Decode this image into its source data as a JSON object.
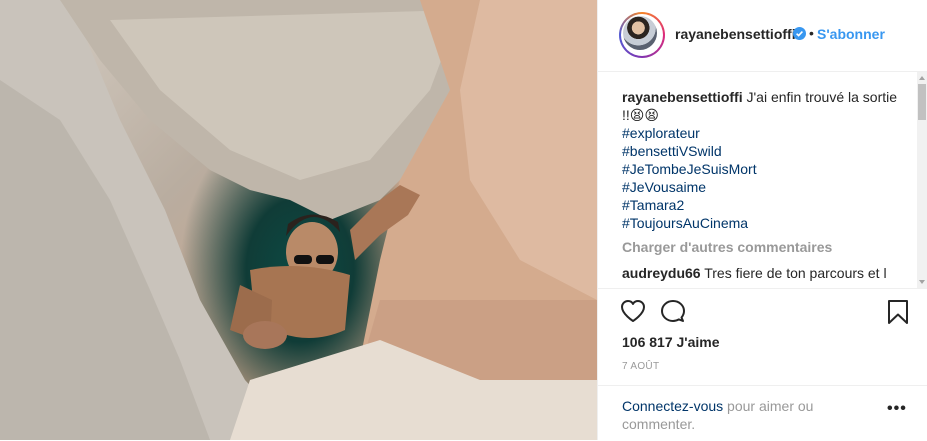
{
  "header": {
    "username": "rayanebensettioffi",
    "separator": "•",
    "follow_label": "S'abonner"
  },
  "caption": {
    "username": "rayanebensettioffi",
    "text": "J'ai enfin trouvé la sortie !!😫😫",
    "hashtags": [
      "#explorateur",
      "#bensettiVSwild",
      "#JeTombeJeSuisMort",
      "#JeVousaime",
      "#Tamara2",
      "#ToujoursAuCinema"
    ]
  },
  "load_more_label": "Charger d'autres commentaires",
  "comment": {
    "username": "audreydu66",
    "text": "Tres fiere de ton parcours et l"
  },
  "likes_text": "106 817 J'aime",
  "date_text": "7 AOÛT",
  "login": {
    "link": "Connectez-vous",
    "text": " pour aimer ou commenter."
  },
  "more_label": "•••",
  "icons": {
    "like": "heart-icon",
    "comment": "comment-bubble-icon",
    "save": "bookmark-icon",
    "verified": "verified-badge-icon"
  },
  "colors": {
    "link_blue": "#3897f0",
    "hashtag_blue": "#003569",
    "muted": "#999999",
    "text": "#262626"
  }
}
